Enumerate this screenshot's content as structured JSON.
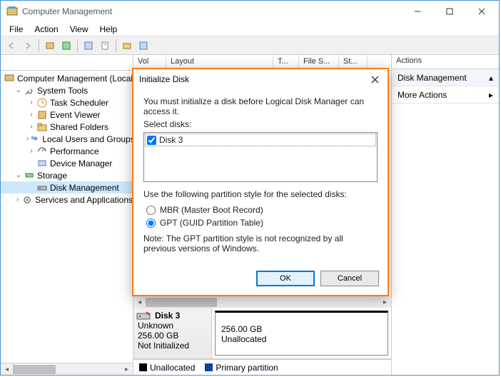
{
  "window": {
    "title": "Computer Management"
  },
  "menu": {
    "file": "File",
    "action": "Action",
    "view": "View",
    "help": "Help"
  },
  "tree": {
    "root": "Computer Management (Local)",
    "system_tools": "System Tools",
    "task_scheduler": "Task Scheduler",
    "event_viewer": "Event Viewer",
    "shared_folders": "Shared Folders",
    "local_users": "Local Users and Groups",
    "performance": "Performance",
    "device_manager": "Device Manager",
    "storage": "Storage",
    "disk_management": "Disk Management",
    "services": "Services and Applications"
  },
  "volume_cols": {
    "vol": "Vol",
    "layout": "Layout",
    "type": "T...",
    "fs": "File S...",
    "status": "St..."
  },
  "disk": {
    "name": "Disk 3",
    "status": "Unknown",
    "size": "256.00 GB",
    "init": "Not Initialized",
    "part_size": "256.00 GB",
    "part_status": "Unallocated"
  },
  "legend": {
    "unallocated": "Unallocated",
    "primary": "Primary partition"
  },
  "actions": {
    "header": "Actions",
    "disk_mgmt": "Disk Management",
    "more": "More Actions"
  },
  "dialog": {
    "title": "Initialize Disk",
    "instruction": "You must initialize a disk before Logical Disk Manager can access it.",
    "select_label": "Select disks:",
    "disk_item": "Disk 3",
    "partition_prompt": "Use the following partition style for the selected disks:",
    "mbr": "MBR (Master Boot Record)",
    "gpt": "GPT (GUID Partition Table)",
    "note": "Note: The GPT partition style is not recognized by all previous versions of Windows.",
    "ok": "OK",
    "cancel": "Cancel"
  }
}
